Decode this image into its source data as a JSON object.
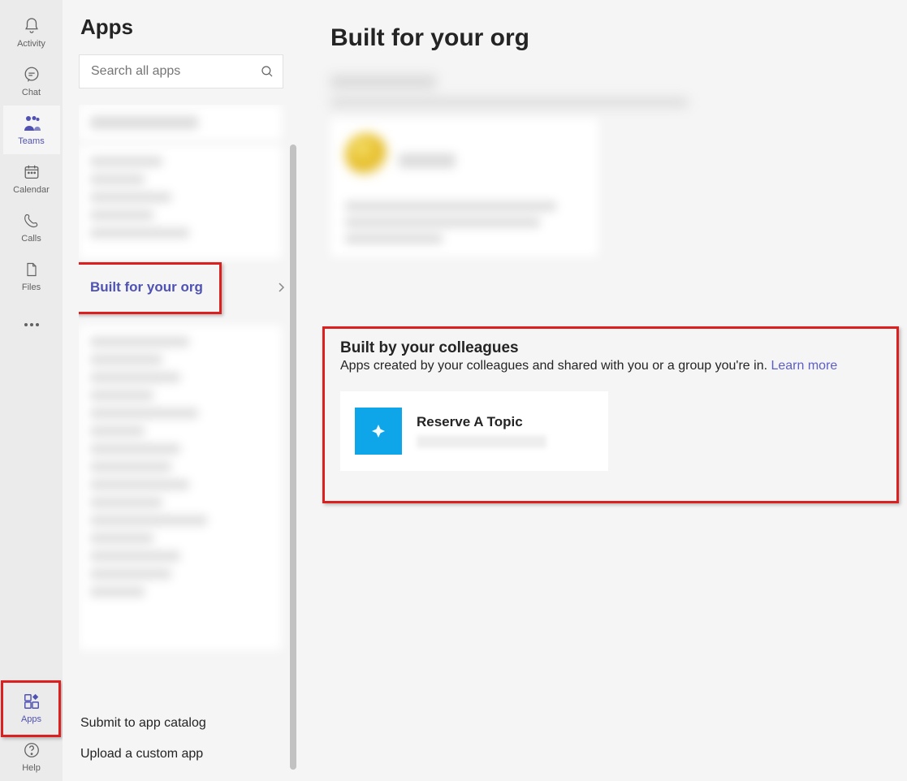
{
  "rail": {
    "activity": "Activity",
    "chat": "Chat",
    "teams": "Teams",
    "calendar": "Calendar",
    "calls": "Calls",
    "files": "Files",
    "apps": "Apps",
    "help": "Help"
  },
  "left": {
    "title": "Apps",
    "search_placeholder": "Search all apps",
    "built_for_org": "Built for your org",
    "submit": "Submit to app catalog",
    "upload": "Upload a custom app"
  },
  "main": {
    "heading": "Built for your org",
    "section": {
      "title": "Built by your colleagues",
      "subtitle_1": "Apps created by your colleagues and shared with you or a group you're in. ",
      "learn_more": "Learn more"
    },
    "app": {
      "name": "Reserve A Topic"
    }
  },
  "colors": {
    "accent": "#4f52b2",
    "highlight": "#dc1f1f",
    "app_icon": "#0ea6e9"
  }
}
